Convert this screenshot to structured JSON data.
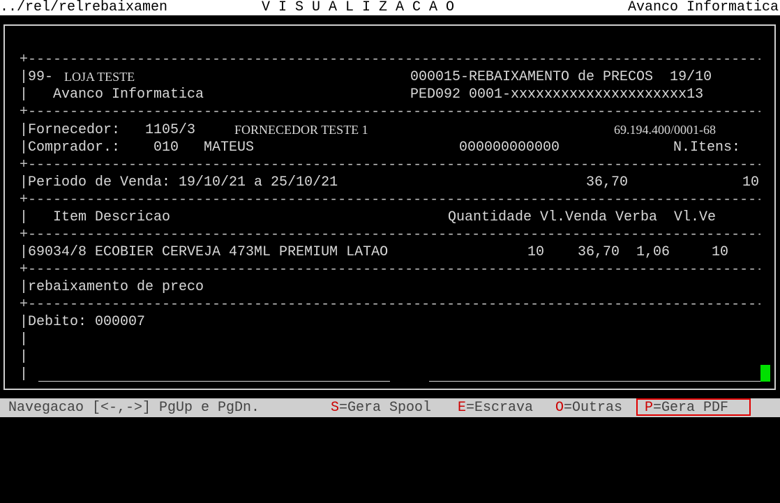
{
  "topbar": {
    "path": "../rel/relrebaixamen",
    "title": "V I S U A L I Z A C A O",
    "vendor": "Avanco Informatica"
  },
  "report": {
    "separator": "+----------------------------------------------------------------------------------------------------------------------------",
    "store_code": "|99-",
    "store_name": "LOJA TESTE",
    "report_title": "000015-REBAIXAMENTO de PRECOS  19/10",
    "company_line": "|   Avanco Informatica",
    "ped_line": "PED092 0001-xxxxxxxxxxxxxxxxxxxxx13",
    "supplier_label": "|Fornecedor:   1105/3",
    "supplier_name": "FORNECEDOR TESTE 1",
    "supplier_cnpj": "69.194.400/0001-68",
    "buyer_line": "|Comprador.:    010   MATEUS",
    "buyer_code": "000000000000",
    "items_label": "N.Itens:",
    "period_line": "|Periodo de Venda: 19/10/21 a 25/10/21",
    "period_value": "36,70",
    "period_qty": "10",
    "col_header_left": "|   Item Descricao",
    "col_header_right": "Quantidade Vl.Venda Verba  Vl.Ve",
    "item_line_desc": "|69034/8 ECOBIER CERVEJA 473ML PREMIUM LATAO",
    "item_line_values": "10    36,70  1,06     10",
    "note_line": "|rebaixamento de preco",
    "debit_line": "|Debito: 000007",
    "bar": "|"
  },
  "statusbar": {
    "nav": "Navegacao [<-,->] PgUp e PgDn.",
    "spool_key": "S",
    "spool_label": "=Gera Spool",
    "print_key": "E",
    "print_label": "=Escrava",
    "other_key": "O",
    "other_label": "=Outras",
    "pdf_key": "P",
    "pdf_label": "=Gera PDF"
  }
}
